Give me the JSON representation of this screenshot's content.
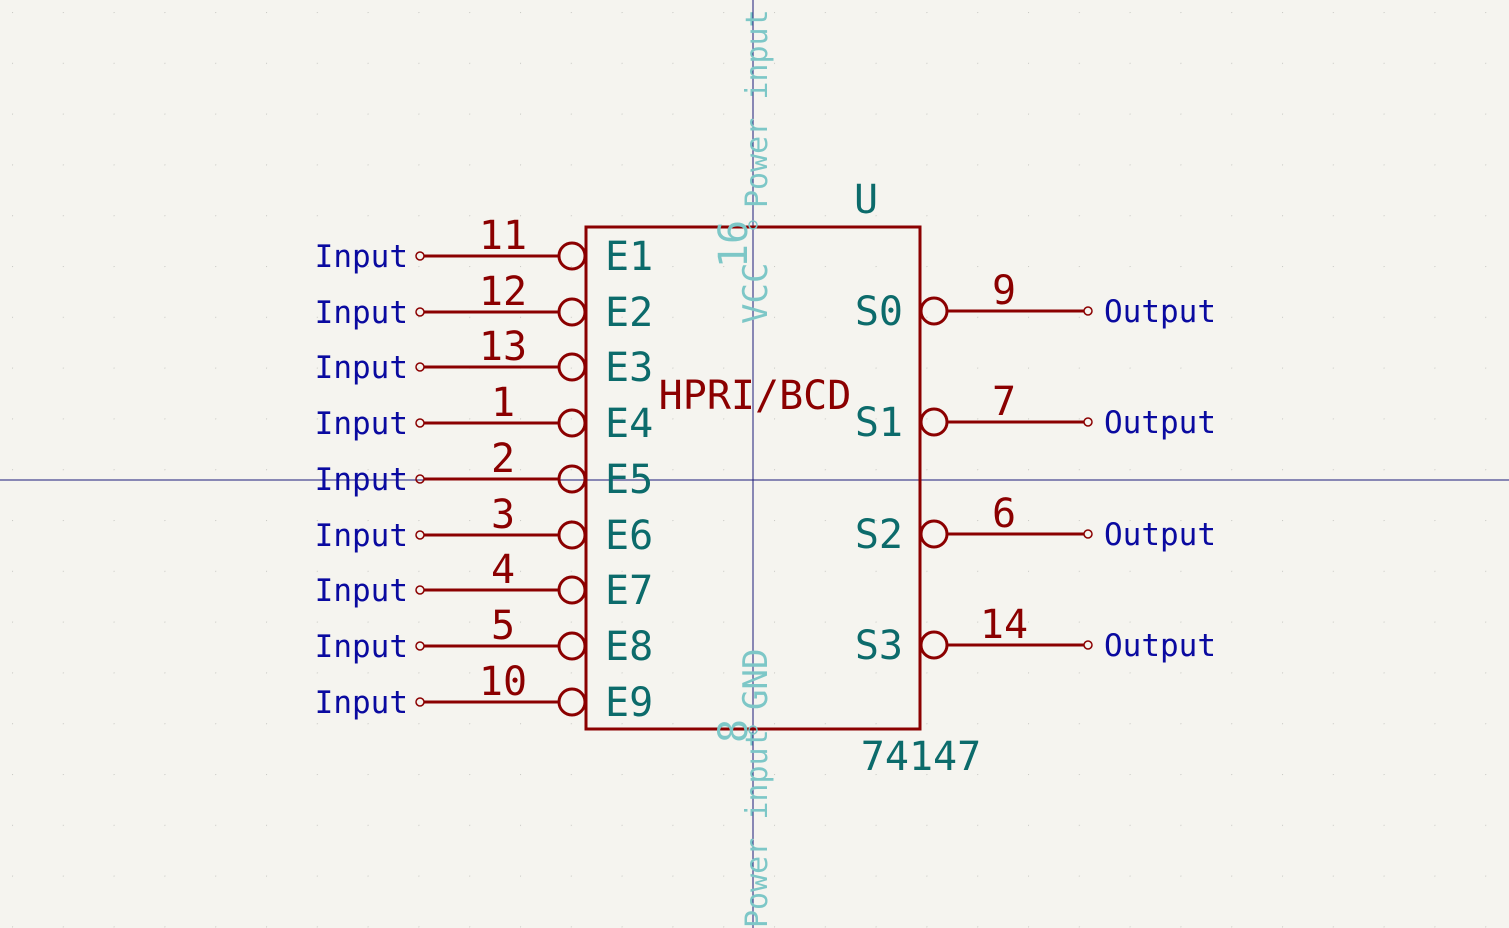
{
  "component": {
    "reference": "U",
    "value": "74147",
    "function_label": "HPRI/BCD"
  },
  "input_pins": [
    {
      "number": "11",
      "name": "E1",
      "type": "Input"
    },
    {
      "number": "12",
      "name": "E2",
      "type": "Input"
    },
    {
      "number": "13",
      "name": "E3",
      "type": "Input"
    },
    {
      "number": "1",
      "name": "E4",
      "type": "Input"
    },
    {
      "number": "2",
      "name": "E5",
      "type": "Input"
    },
    {
      "number": "3",
      "name": "E6",
      "type": "Input"
    },
    {
      "number": "4",
      "name": "E7",
      "type": "Input"
    },
    {
      "number": "5",
      "name": "E8",
      "type": "Input"
    },
    {
      "number": "10",
      "name": "E9",
      "type": "Input"
    }
  ],
  "output_pins": [
    {
      "number": "9",
      "name": "S0",
      "type": "Output"
    },
    {
      "number": "7",
      "name": "S1",
      "type": "Output"
    },
    {
      "number": "6",
      "name": "S2",
      "type": "Output"
    },
    {
      "number": "14",
      "name": "S3",
      "type": "Output"
    }
  ],
  "power_pins": {
    "top": {
      "number": "16",
      "name": "VCC",
      "type": "Power input"
    },
    "bottom": {
      "number": "8",
      "name": "GND",
      "type": "Power input"
    }
  },
  "colors": {
    "background": "#f5f4ef",
    "body_outline": "#8b0000",
    "pin_line": "#8b0000",
    "pin_name": "#0c6b6b",
    "pin_type": "#0a0aa0",
    "power": "#7dc7c7",
    "crosshair": "#1a1a7a",
    "grid_dot": "#c9c9c4"
  }
}
